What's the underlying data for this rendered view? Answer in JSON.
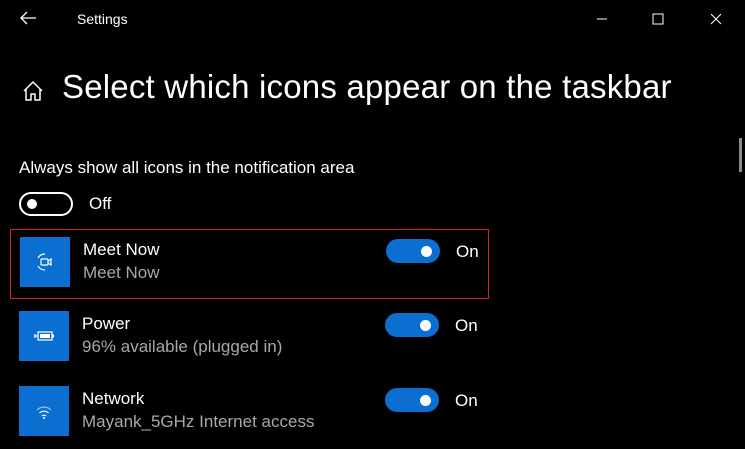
{
  "window": {
    "title": "Settings"
  },
  "page": {
    "title": "Select which icons appear on the taskbar"
  },
  "always_show": {
    "label": "Always show all icons in the notification area",
    "state": "Off"
  },
  "items": [
    {
      "name": "Meet Now",
      "description": "Meet Now",
      "state": "On",
      "icon": "meet-now-icon",
      "selected": true
    },
    {
      "name": "Power",
      "description": "96% available (plugged in)",
      "state": "On",
      "icon": "battery-plugged-icon",
      "selected": false
    },
    {
      "name": "Network",
      "description": "Mayank_5GHz Internet access",
      "state": "On",
      "icon": "wifi-icon",
      "selected": false
    }
  ],
  "colors": {
    "accent": "#0a6fd1",
    "selection_border": "#d0262e",
    "background": "#000000",
    "secondary_text": "#a8a8a8"
  }
}
